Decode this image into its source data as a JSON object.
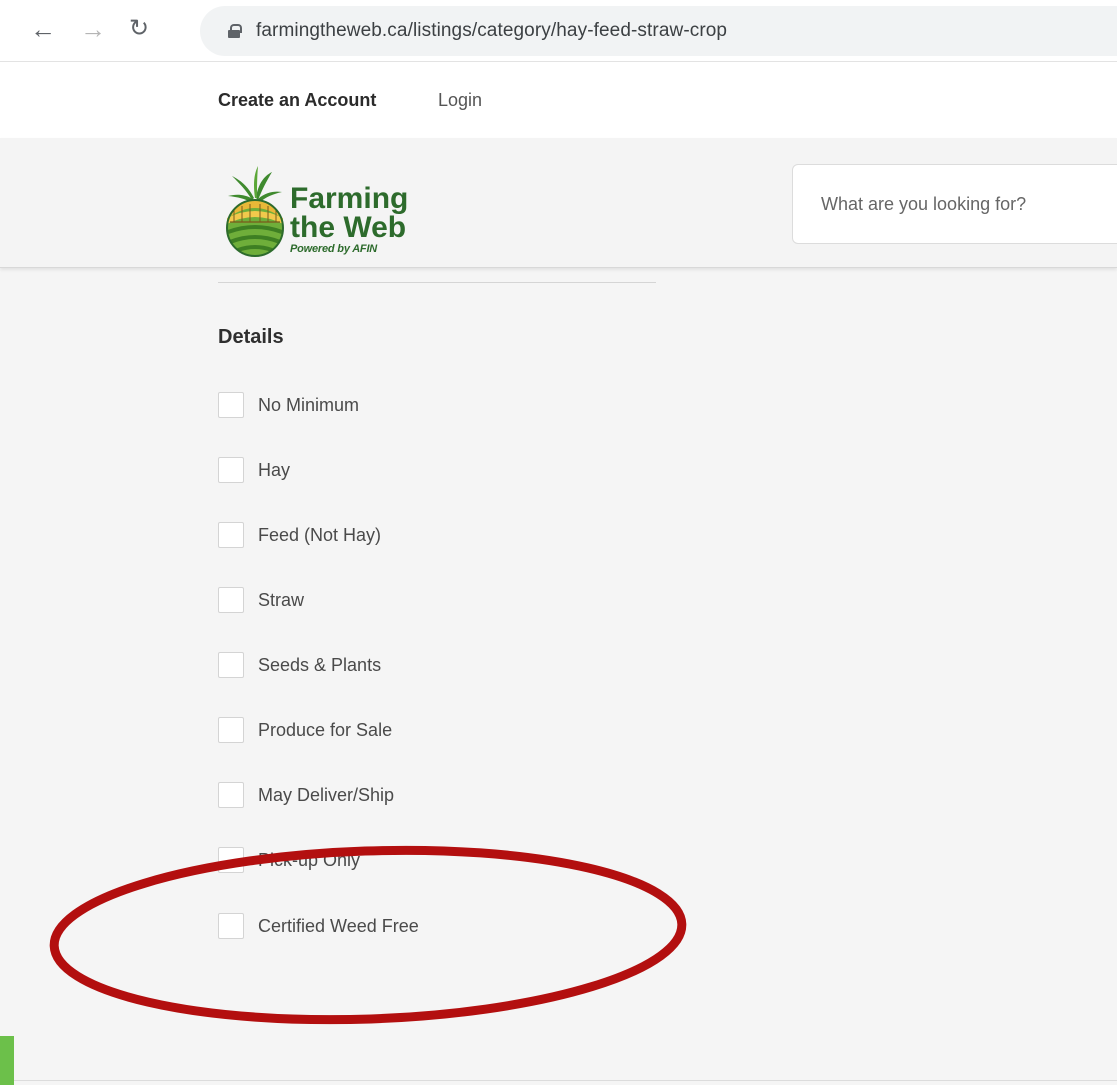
{
  "browser": {
    "url": "farmingtheweb.ca/listings/category/hay-feed-straw-crop",
    "icons": {
      "back": "arrow-left-icon",
      "forward": "arrow-right-icon",
      "reload": "reload-icon",
      "lock": "lock-icon"
    }
  },
  "account": {
    "create_account": "Create an Account",
    "login": "Login"
  },
  "header": {
    "logo_line1": "Farming",
    "logo_line2": "the Web",
    "logo_tagline": "Powered by AFIN",
    "search_placeholder": "What are you looking for?"
  },
  "filters": {
    "title": "Details",
    "items": [
      {
        "label": "No Minimum",
        "checked": false
      },
      {
        "label": "Hay",
        "checked": false
      },
      {
        "label": "Feed (Not Hay)",
        "checked": false
      },
      {
        "label": "Straw",
        "checked": false
      },
      {
        "label": "Seeds & Plants",
        "checked": false
      },
      {
        "label": "Produce for Sale",
        "checked": false
      },
      {
        "label": "May Deliver/Ship",
        "checked": false
      },
      {
        "label": "Pick-up Only",
        "checked": false
      },
      {
        "label": "Certified Weed Free",
        "checked": false
      }
    ]
  },
  "colors": {
    "brand_green": "#2d6b2c",
    "annotation_red": "#b30f0f",
    "accent_green": "#6cc04a"
  }
}
